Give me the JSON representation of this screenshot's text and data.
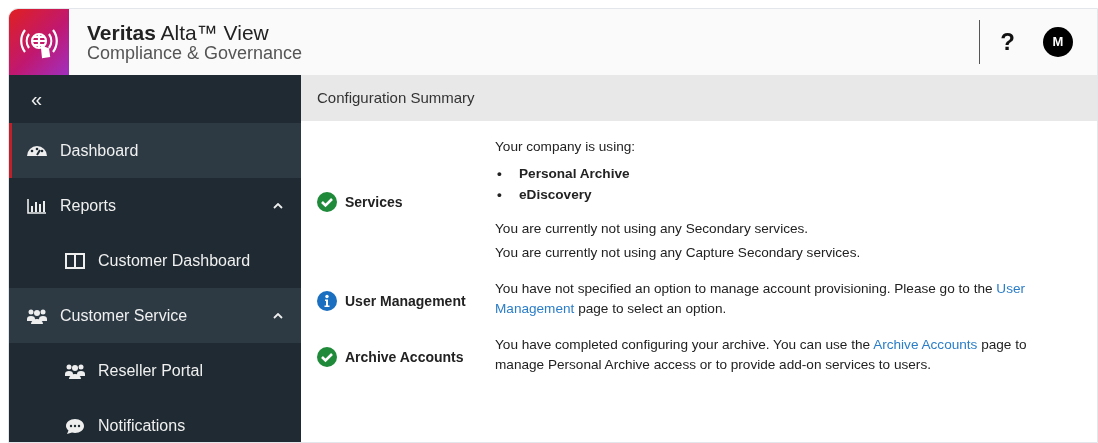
{
  "header": {
    "brand": "Veritas",
    "product": "Alta™ View",
    "subtitle": "Compliance & Governance",
    "help": "?",
    "avatar": "M"
  },
  "sidebar": {
    "collapse": "«",
    "items": [
      {
        "label": "Dashboard",
        "selected": true,
        "highlight": true
      },
      {
        "label": "Reports",
        "selected": false,
        "highlight": false,
        "expanded": true,
        "children": [
          {
            "label": "Customer Dashboard",
            "selected": false
          }
        ]
      },
      {
        "label": "Customer Service",
        "selected": false,
        "highlight": true,
        "expanded": true,
        "children": [
          {
            "label": "Reseller Portal",
            "selected": false
          },
          {
            "label": "Notifications",
            "selected": false
          }
        ]
      }
    ]
  },
  "content": {
    "title": "Configuration Summary",
    "rows": [
      {
        "label": "Services",
        "kind": "ok",
        "blocks": [
          {
            "kind": "text",
            "lines": [
              [
                {
                  "kind": "text",
                  "text": "Your company is using:"
                }
              ]
            ]
          },
          {
            "kind": "list",
            "items": [
              {
                "bullet": "•",
                "text": "Personal Archive"
              },
              {
                "bullet": "•",
                "text": "eDiscovery"
              }
            ]
          },
          {
            "kind": "text",
            "lines": [
              [
                {
                  "kind": "text",
                  "text": "You are currently not using any Secondary services."
                }
              ]
            ]
          },
          {
            "kind": "text",
            "lines": [
              [
                {
                  "kind": "text",
                  "text": "You are currently not using any Capture Secondary services."
                }
              ]
            ]
          }
        ]
      },
      {
        "label": "User Management",
        "kind": "info",
        "blocks": [
          {
            "kind": "text",
            "lines": [
              [
                {
                  "kind": "text",
                  "text": "You have not specified an option to manage account provisioning. Please go to the "
                },
                {
                  "kind": "link",
                  "text": "User"
                }
              ],
              [
                {
                  "kind": "link",
                  "text": "Management"
                },
                {
                  "kind": "text",
                  "text": " page to select an option."
                }
              ]
            ]
          }
        ]
      },
      {
        "label": "Archive Accounts",
        "kind": "ok",
        "blocks": [
          {
            "kind": "text",
            "lines": [
              [
                {
                  "kind": "text",
                  "text": "You have completed configuring your archive. You can use the "
                },
                {
                  "kind": "link",
                  "text": "Archive Accounts"
                },
                {
                  "kind": "text",
                  "text": " page to"
                }
              ],
              [
                {
                  "kind": "text",
                  "text": "manage Personal Archive access or to provide add-on services to users."
                }
              ]
            ]
          }
        ]
      }
    ]
  }
}
